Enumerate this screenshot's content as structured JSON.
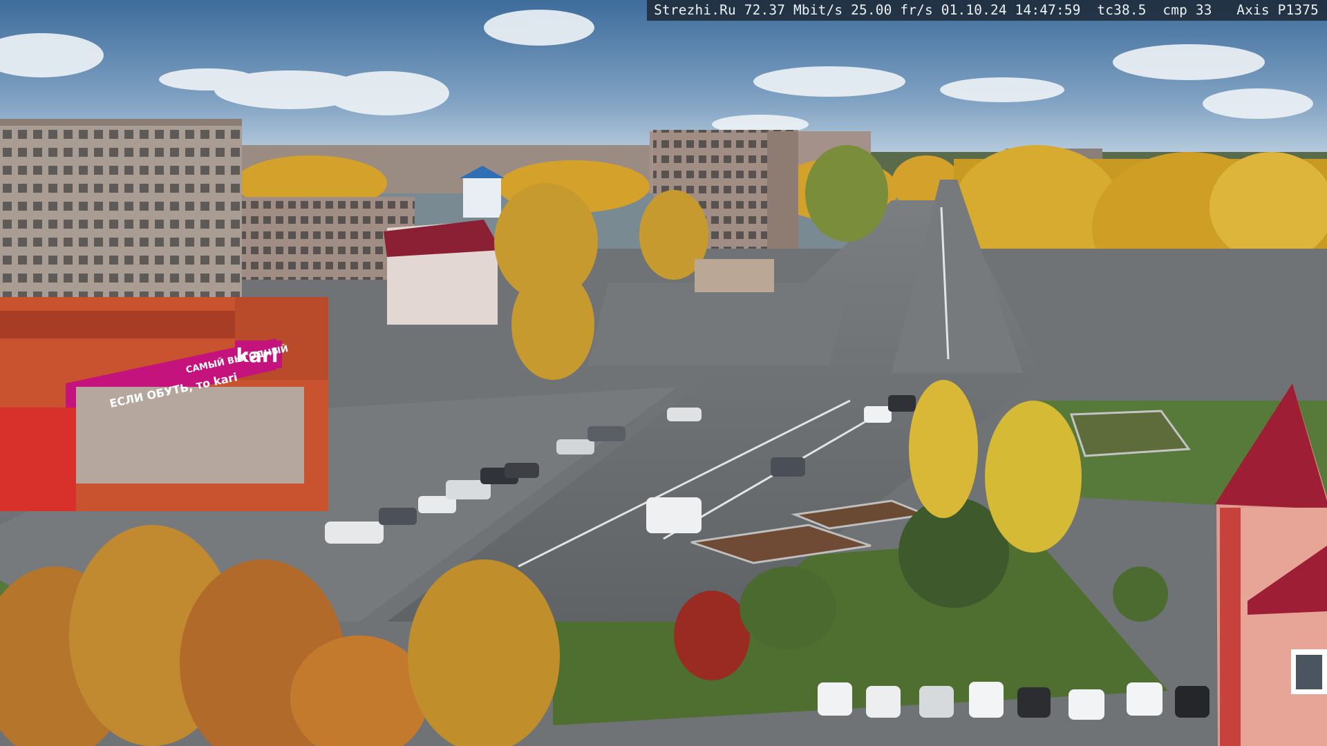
{
  "overlay": {
    "site": "Strezhi.Ru",
    "bitrate": "72.37 Mbit/s",
    "framerate": "25.00 fr/s",
    "datetime": "01.10.24 14:47:59",
    "temp": "tc38.5",
    "compression": "cmp 33",
    "camera": "Axis P1375"
  },
  "storefront": {
    "brand": "kari",
    "banner_line1": "САМЫЙ ВЫГОДНЫЙ",
    "banner_line2": "ЕСЛИ ОБУТЬ, то kari"
  },
  "colors": {
    "sky_top": "#3f6f9e",
    "sky_bottom": "#b9cde0",
    "asphalt": "#6a6e72",
    "foliage": "#d7a726",
    "grass": "#5b7d36",
    "kari_magenta": "#c4137c",
    "store_red": "#c84a2e"
  }
}
